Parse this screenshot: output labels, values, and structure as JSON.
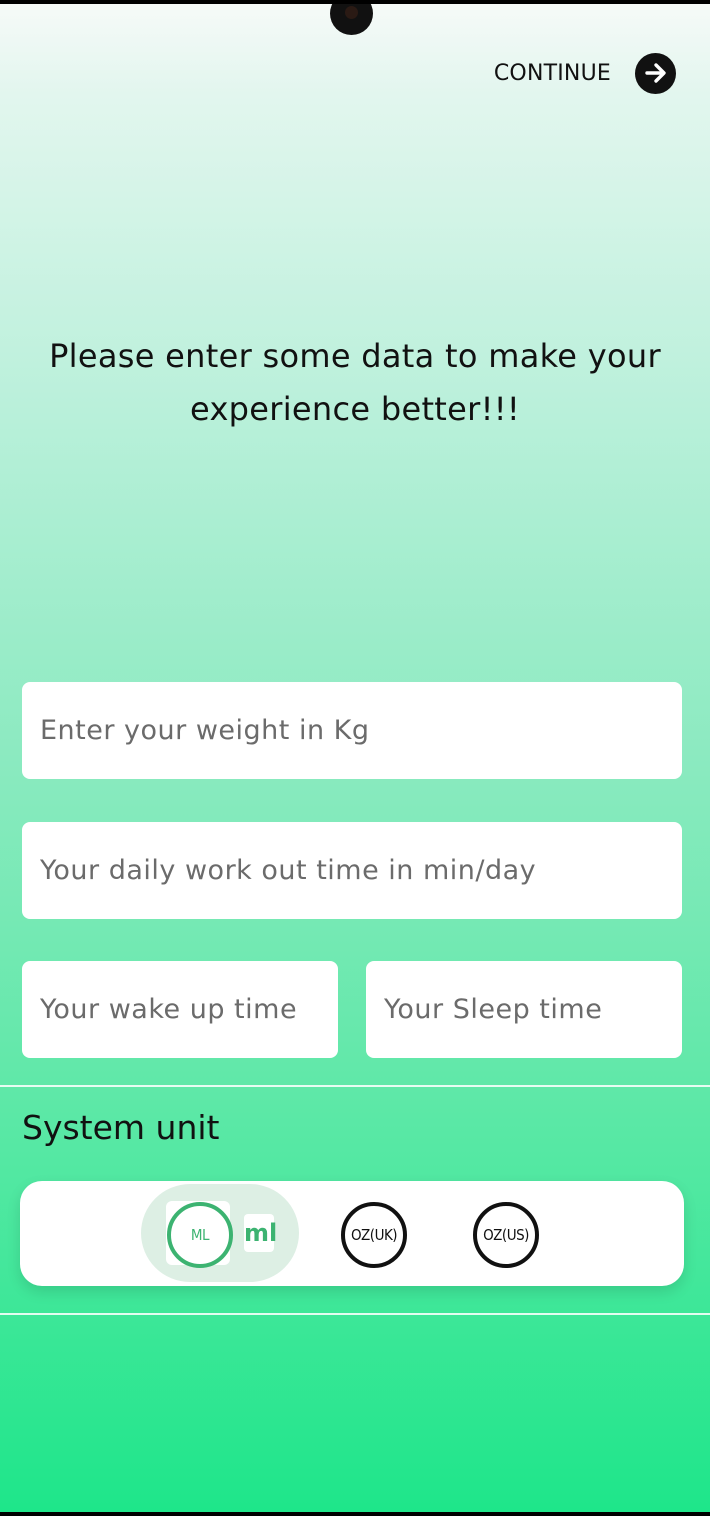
{
  "header": {
    "continue_label": "CONTINUE",
    "continue_icon": "arrow-right-circle-icon"
  },
  "prompt": {
    "text": "Please enter some data to make your experience better!!!"
  },
  "form": {
    "weight_placeholder": "Enter your weight in Kg",
    "workout_placeholder": "Your daily work out time in min/day",
    "wake_placeholder": "Your wake up time",
    "sleep_placeholder": "Your Sleep time"
  },
  "units": {
    "title": "System unit",
    "options": [
      {
        "label": "ML",
        "selected": true
      },
      {
        "label": "OZ(UK)",
        "selected": false
      },
      {
        "label": "OZ(US)",
        "selected": false
      }
    ],
    "selected_suffix": "ml",
    "accent_color": "#3cb371"
  },
  "colors": {
    "gradient_top": "#f6faf8",
    "gradient_bottom": "#1ee68a"
  }
}
